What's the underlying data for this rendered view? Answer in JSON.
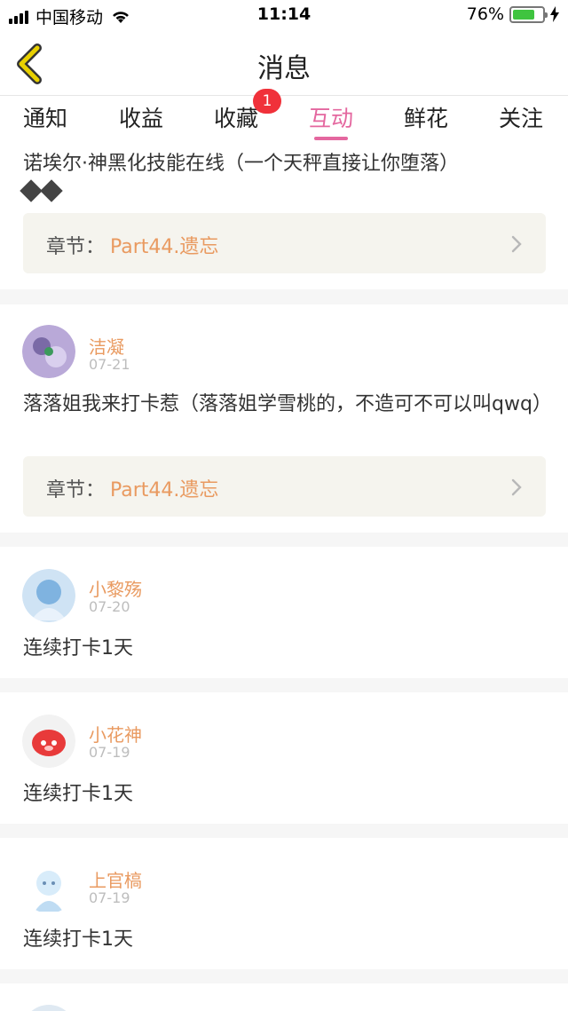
{
  "status_bar": {
    "carrier": "中国移动",
    "time": "11:14",
    "battery_percent_text": "76%",
    "battery_level": 0.76
  },
  "nav": {
    "title": "消息"
  },
  "tabs": [
    {
      "label": "通知"
    },
    {
      "label": "收益"
    },
    {
      "label": "收藏",
      "badge": "1"
    },
    {
      "label": "互动"
    },
    {
      "label": "鲜花"
    },
    {
      "label": "关注"
    }
  ],
  "active_tab": "互动",
  "messages": [
    {
      "text": "诺埃尔·神黑化技能在线（一个天秤直接让你堕落）",
      "chapter_label": "章节：",
      "chapter_value": "Part44.遗忘"
    },
    {
      "user": "洁凝",
      "date": "07-21",
      "text": "落落姐我来打卡惹（落落姐学雪桃的，不造可不可以叫qwq）",
      "chapter_label": "章节：",
      "chapter_value": "Part44.遗忘"
    },
    {
      "user": "小黎殇",
      "date": "07-20",
      "text": "连续打卡1天"
    },
    {
      "user": "小花神",
      "date": "07-19",
      "text": "连续打卡1天"
    },
    {
      "user": "上官槁",
      "date": "07-19",
      "text": "连续打卡1天"
    }
  ],
  "colors": {
    "accent": "#e4679f",
    "username": "#e99a60",
    "badge": "#f0313a",
    "back_arrow": "#e8d000"
  }
}
